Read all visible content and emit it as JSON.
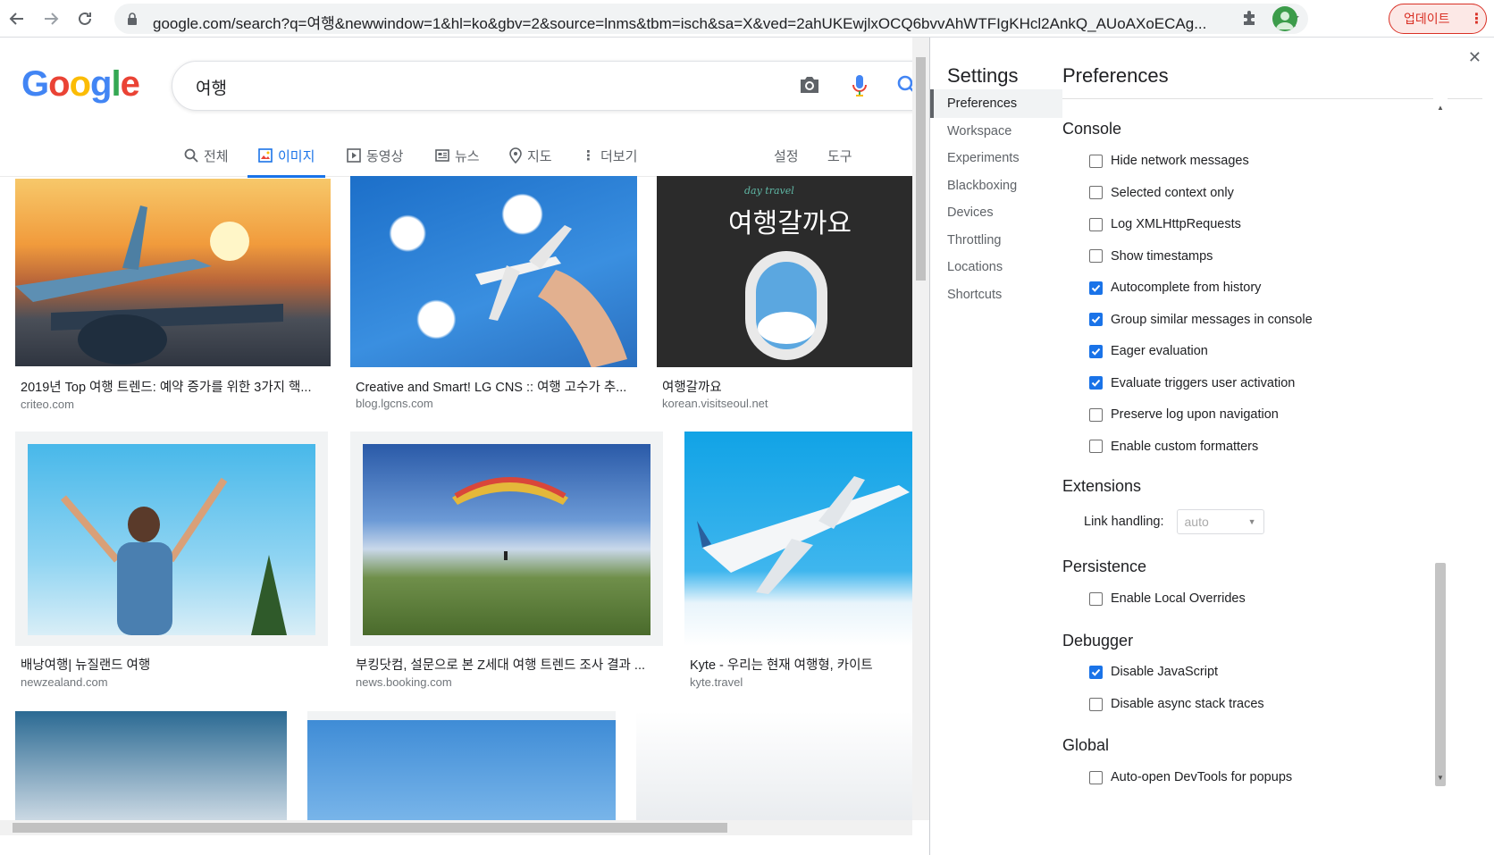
{
  "browser": {
    "url": "google.com/search?q=여행&newwindow=1&hl=ko&gbv=2&source=lnms&tbm=isch&sa=X&ved=2ahUKEwjlxOCQ6bvvAhWTFIgKHcl2AnkQ_AUoAXoECAg...",
    "update_label": "업데이트"
  },
  "google": {
    "logo_letters": [
      "G",
      "o",
      "o",
      "g",
      "l",
      "e"
    ],
    "query": "여행",
    "tabs": [
      {
        "label": "전체",
        "icon": "search-icon"
      },
      {
        "label": "이미지",
        "icon": "image-icon"
      },
      {
        "label": "동영상",
        "icon": "video-icon"
      },
      {
        "label": "뉴스",
        "icon": "news-icon"
      },
      {
        "label": "지도",
        "icon": "map-pin-icon"
      },
      {
        "label": "더보기",
        "icon": "more-vert-icon"
      }
    ],
    "settings_label": "설정",
    "tools_label": "도구",
    "results": [
      {
        "caption": "2019년 Top 여행 트렌드: 예약 증가를 위한 3가지 핵...",
        "source": "criteo.com"
      },
      {
        "caption": "Creative and Smart! LG CNS :: 여행 고수가 추...",
        "source": "blog.lgcns.com"
      },
      {
        "caption": "여행갈까요",
        "source": "korean.visitseoul.net",
        "image_text": "여행갈까요",
        "image_script": "day travel"
      },
      {
        "caption": "배낭여행| 뉴질랜드 여행",
        "source": "newzealand.com"
      },
      {
        "caption": "부킹닷컴, 설문으로 본 Z세대 여행 트렌드 조사 결과 ...",
        "source": "news.booking.com"
      },
      {
        "caption": "Kyte - 우리는 현재 여행형, 카이트",
        "source": "kyte.travel"
      }
    ]
  },
  "devtools": {
    "settings_title": "Settings",
    "panel_title": "Preferences",
    "nav": [
      "Preferences",
      "Workspace",
      "Experiments",
      "Blackboxing",
      "Devices",
      "Throttling",
      "Locations",
      "Shortcuts"
    ],
    "sections": {
      "console": {
        "title": "Console",
        "options": [
          {
            "label": "Hide network messages",
            "checked": false
          },
          {
            "label": "Selected context only",
            "checked": false
          },
          {
            "label": "Log XMLHttpRequests",
            "checked": false
          },
          {
            "label": "Show timestamps",
            "checked": false
          },
          {
            "label": "Autocomplete from history",
            "checked": true
          },
          {
            "label": "Group similar messages in console",
            "checked": true
          },
          {
            "label": "Eager evaluation",
            "checked": true
          },
          {
            "label": "Evaluate triggers user activation",
            "checked": true
          },
          {
            "label": "Preserve log upon navigation",
            "checked": false
          },
          {
            "label": "Enable custom formatters",
            "checked": false
          }
        ]
      },
      "extensions": {
        "title": "Extensions",
        "link_label": "Link handling:",
        "link_value": "auto"
      },
      "persistence": {
        "title": "Persistence",
        "options": [
          {
            "label": "Enable Local Overrides",
            "checked": false
          }
        ]
      },
      "debugger": {
        "title": "Debugger",
        "options": [
          {
            "label": "Disable JavaScript",
            "checked": true
          },
          {
            "label": "Disable async stack traces",
            "checked": false
          }
        ]
      },
      "global": {
        "title": "Global",
        "options": [
          {
            "label": "Auto-open DevTools for popups",
            "checked": false
          }
        ]
      }
    }
  },
  "colors": {
    "accent": "#1a73e8",
    "update_red": "#d93025"
  }
}
